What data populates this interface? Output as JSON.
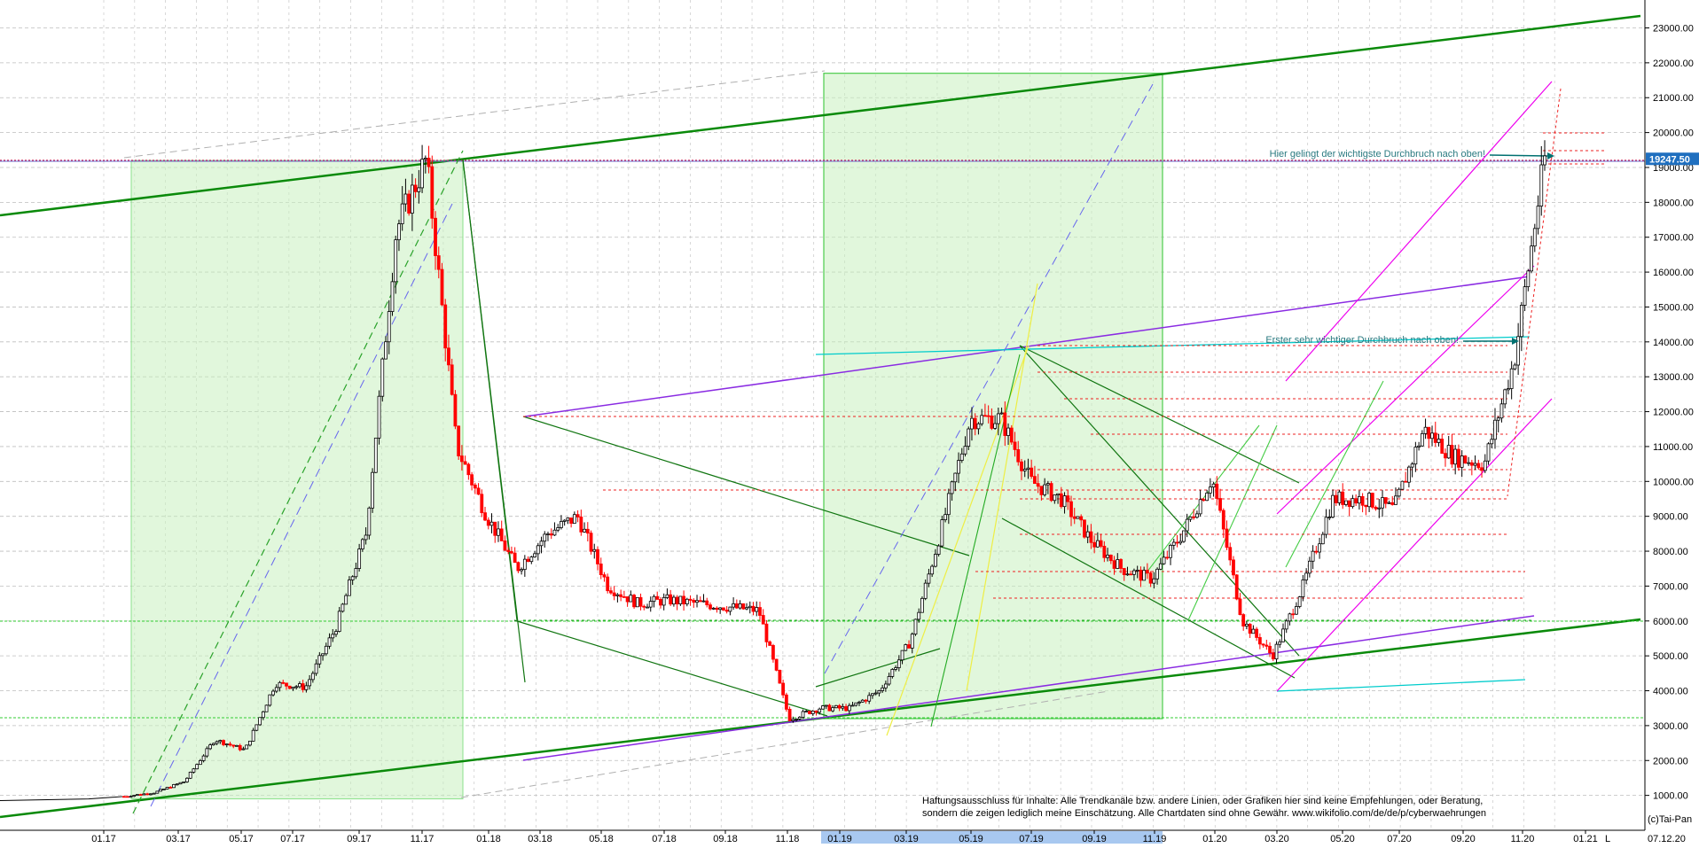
{
  "chart_data": {
    "type": "candlestick",
    "title": "",
    "y_axis": {
      "ylim": [
        0,
        23800
      ],
      "ticks": [
        1000,
        2000,
        3000,
        4000,
        5000,
        6000,
        7000,
        8000,
        9000,
        10000,
        11000,
        12000,
        13000,
        14000,
        15000,
        16000,
        17000,
        18000,
        19000,
        20000,
        21000,
        22000,
        23000
      ],
      "tick_labels": [
        "1000.00",
        "2000.00",
        "3000.00",
        "4000.00",
        "5000.00",
        "6000.00",
        "7000.00",
        "8000.00",
        "9000.00",
        "10000.00",
        "11000.00",
        "12000.00",
        "13000.00",
        "14000.00",
        "15000.00",
        "16000.00",
        "17000.00",
        "18000.00",
        "19000.00",
        "20000.00",
        "21000.00",
        "22000.00",
        "23000.00"
      ],
      "side": "right"
    },
    "x_axis": {
      "tick_labels": [
        "01.17",
        "03.17",
        "05.17",
        "07.17",
        "09.17",
        "11.17",
        "01.18",
        "03.18",
        "05.18",
        "07.18",
        "09.18",
        "11.18",
        "01.19",
        "03.19",
        "05.19",
        "07.19",
        "09.19",
        "11.19",
        "01.20",
        "03.20",
        "05.20",
        "07.20",
        "09.20",
        "11.20",
        "01.21"
      ],
      "highlighted_label": "01.19",
      "end_date_label": "07.12.20",
      "scale_indicator": "L"
    },
    "price_series": {
      "x": [
        "01.17",
        "03.17",
        "05.17",
        "06.17",
        "07.17",
        "08.17",
        "09.17",
        "10.17",
        "11.17",
        "12.17",
        "12.17b",
        "01.18",
        "02.18",
        "03.18",
        "04.18",
        "05.18",
        "06.18",
        "07.18",
        "08.18",
        "09.18",
        "10.18",
        "11.18",
        "12.18",
        "01.19",
        "02.19",
        "03.19",
        "04.19",
        "05.19",
        "06.19",
        "07.19",
        "08.19",
        "09.19",
        "10.19",
        "11.19",
        "12.19",
        "01.20",
        "02.20",
        "03.20",
        "03.20b",
        "04.20",
        "05.20",
        "06.20",
        "07.20",
        "08.20",
        "09.20",
        "10.20",
        "11.20",
        "12.20"
      ],
      "close": [
        970,
        1080,
        1400,
        2600,
        2300,
        4200,
        4100,
        5800,
        8500,
        17200,
        19247,
        11000,
        9000,
        7500,
        8500,
        9000,
        7000,
        6500,
        6600,
        6500,
        6400,
        6300,
        3200,
        3500,
        3500,
        4000,
        5400,
        8500,
        11800,
        11800,
        10000,
        9500,
        8300,
        7500,
        7200,
        8500,
        10100,
        6000,
        5000,
        7000,
        9500,
        9500,
        9200,
        11500,
        10700,
        10500,
        13500,
        19247
      ]
    },
    "last_price_label": "19247.50",
    "annotations": [
      {
        "text": "Hier gelingt der wichtigste Durchbruch nach oben!",
        "arrow": "right"
      },
      {
        "text": "Erster sehr wichtiger Durchbruch nach oben!",
        "arrow": "right"
      }
    ],
    "disclaimer": [
      "Haftungsausschluss für Inhalte: Alle Trendkanäle bzw. andere Linien, oder Grafiken hier sind keine Empfehlungen, oder Beratung,",
      "sondern die zeigen lediglich meine  Einschätzung. Alle Chartdaten sind ohne Gewähr.  www.wikifolio.com/de/de/p/cyberwaehrungen"
    ],
    "copyright": "(c)Tai-Pan",
    "grid": true,
    "colors": {
      "candle_up": "#000000",
      "candle_down": "#ff0000",
      "trend_green_dark": "#0a8a0a",
      "trend_purple": "#8a2be2",
      "trend_magenta": "#ee00ee",
      "trend_cyan": "#00cccc",
      "zone_fill": "#c8f0c0",
      "annotation_text": "#2a7a80",
      "last_price_bg": "#1f6fbf"
    }
  }
}
